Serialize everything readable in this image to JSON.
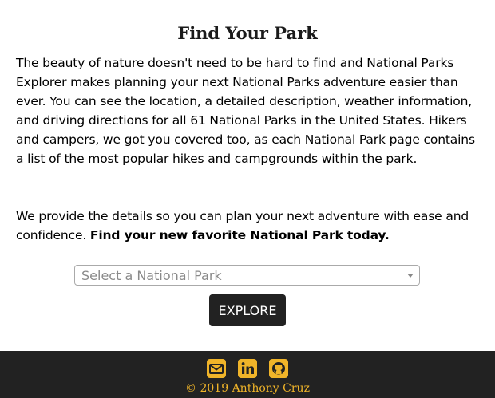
{
  "page": {
    "title": "Find Your Park",
    "intro": "The beauty of nature doesn't need to be hard to find and National Parks Explorer makes planning your next National Parks adventure easier than ever. You can see the location, a detailed description, weather information, and driving directions for all 61 National Parks in the United States. Hikers and campers, we got you covered too, as each National Park page contains a list of the most popular hikes and campgrounds within the park.",
    "details_text": "We provide the details so you can plan your next adventure with ease and confidence. ",
    "details_bold": "Find your new favorite National Park today."
  },
  "search": {
    "select_placeholder": "Select a National Park",
    "explore_label": "EXPLORE"
  },
  "footer": {
    "copyright": "© 2019 Anthony Cruz",
    "icon_color": "#f0b429",
    "background_color": "#222222",
    "icons": [
      "envelope-icon",
      "linkedin-icon",
      "github-icon"
    ]
  }
}
